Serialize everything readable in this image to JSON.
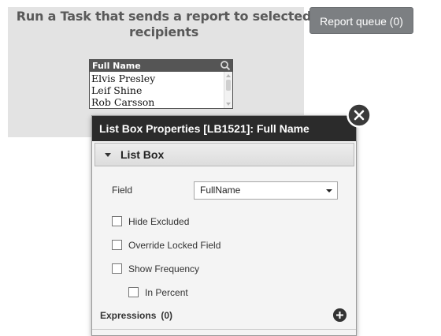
{
  "task": {
    "title": "Run a Task that sends a report to selected recipients"
  },
  "report_queue": {
    "label": "Report queue (0)"
  },
  "listbox": {
    "header": "Full Name",
    "items": [
      "Elvis Presley",
      "Leif Shine",
      "Rob Carsson"
    ]
  },
  "properties": {
    "title": "List Box Properties [LB1521]: Full Name",
    "section": "List Box",
    "field_label": "Field",
    "field_value": "FullName",
    "checkboxes": {
      "hide_excluded": "Hide Excluded",
      "override_locked": "Override Locked Field",
      "show_frequency": "Show Frequency",
      "in_percent": "In Percent"
    },
    "expressions_label": "Expressions",
    "expressions_count": "(0)"
  },
  "colors": {
    "header_dark": "#2b2b2b",
    "button_gray": "#7c7f82",
    "panel_gray": "#e3e3e3"
  },
  "icons": [
    "search-icon",
    "close-icon",
    "caret-down-icon",
    "add-icon"
  ]
}
